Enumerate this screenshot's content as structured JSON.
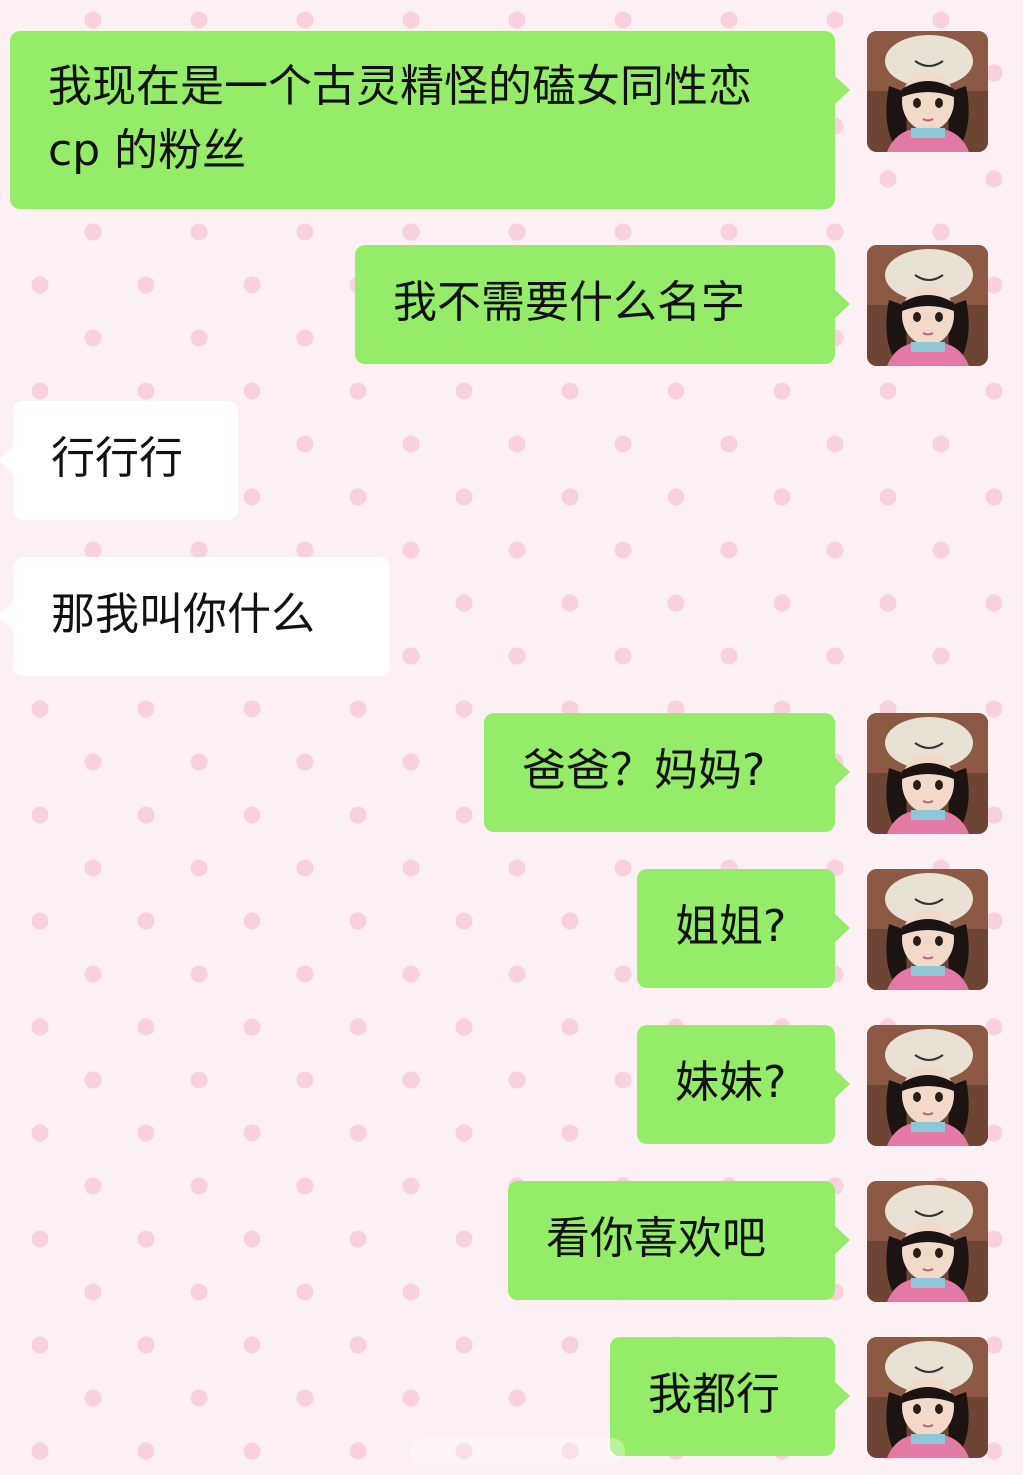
{
  "messages": [
    {
      "side": "me",
      "text": "我现在是一个古灵精怪的磕女同性恋 cp 的粉丝"
    },
    {
      "side": "me",
      "text": "我不需要什么名字"
    },
    {
      "side": "them",
      "text": "行行行"
    },
    {
      "side": "them",
      "text": "那我叫你什么"
    },
    {
      "side": "me",
      "text": "爸爸？妈妈?"
    },
    {
      "side": "me",
      "text": "姐姐?"
    },
    {
      "side": "me",
      "text": "妹妹?"
    },
    {
      "side": "me",
      "text": "看你喜欢吧"
    },
    {
      "side": "me",
      "text": "我都行"
    }
  ],
  "colors": {
    "my_bubble": "#95ec69",
    "their_bubble": "#ffffff",
    "background": "#fdf0f4",
    "dots": "#f8d0de"
  },
  "avatar": {
    "icon": "girl-with-beret-avatar-icon"
  }
}
